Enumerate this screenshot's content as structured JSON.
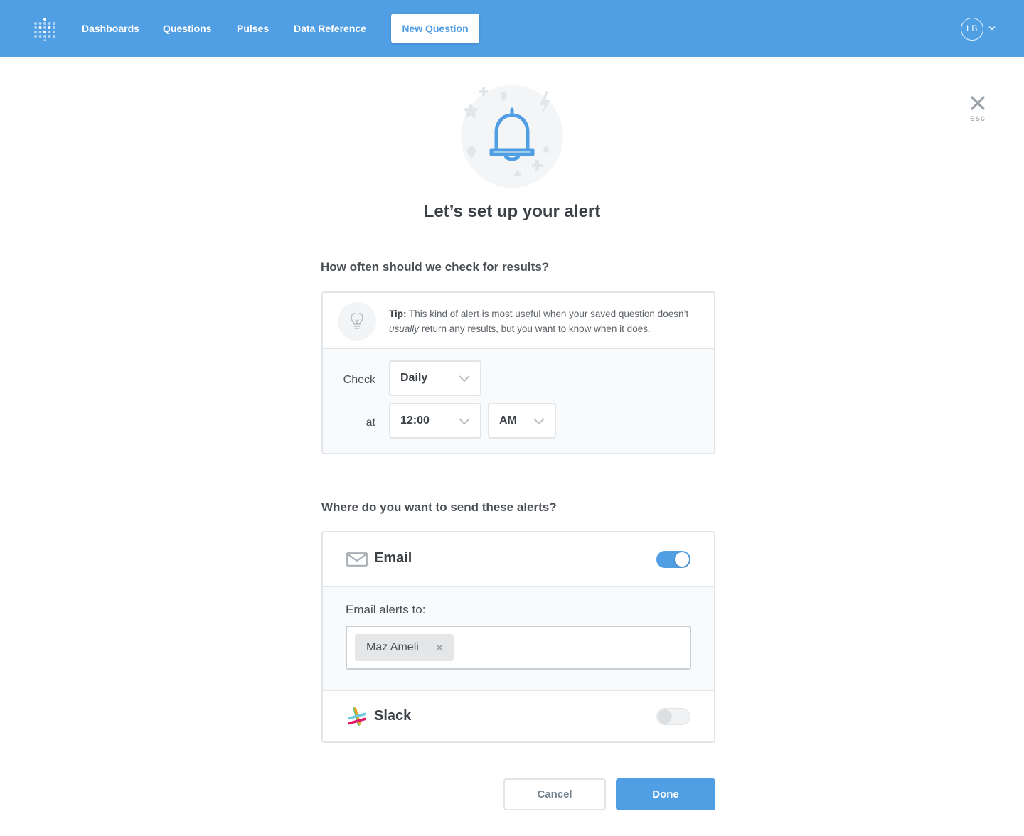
{
  "nav": {
    "links": [
      "Dashboards",
      "Questions",
      "Pulses",
      "Data Reference"
    ],
    "new_question": "New Question",
    "avatar_initials": "LB",
    "brand_color": "#509ee3"
  },
  "close": {
    "label": "esc"
  },
  "page": {
    "title": "Let’s set up your alert"
  },
  "schedule": {
    "heading": "How often should we check for results?",
    "tip_prefix": "Tip:",
    "tip_text_1": " This kind of alert is most useful when your saved question doesn’t ",
    "tip_emphasis": "usually",
    "tip_text_2": " return any results, but you want to know when it does.",
    "check_label": "Check",
    "frequency": "Daily",
    "at_label": "at",
    "hour": "12:00",
    "ampm": "AM"
  },
  "channels": {
    "heading": "Where do you want to send these alerts?",
    "email": {
      "label": "Email",
      "enabled": true,
      "recipients_label": "Email alerts to:",
      "recipients": [
        "Maz Ameli"
      ]
    },
    "slack": {
      "label": "Slack",
      "enabled": false
    }
  },
  "footer": {
    "cancel": "Cancel",
    "done": "Done"
  },
  "icons": [
    "metabase-logo-icon",
    "chevron-down-icon",
    "close-icon",
    "bell-icon",
    "lightbulb-icon",
    "mail-icon",
    "slack-icon",
    "remove-icon"
  ]
}
